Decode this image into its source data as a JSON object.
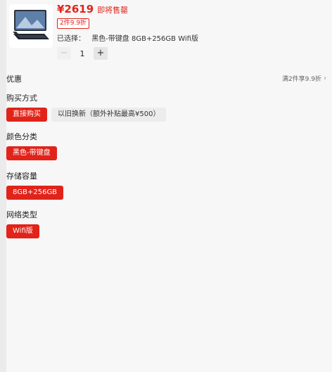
{
  "product": {
    "price": "¥2619",
    "presale": "即将售罄",
    "promo_tag": "2件9.9折",
    "selected_label": "已选择：",
    "selected_value": "黑色-带键盘 8GB+256GB Wifi版",
    "quantity": "1",
    "minus": "−",
    "plus": "+",
    "thumbnail_icon": "tablet-with-keyboard-icon"
  },
  "discount": {
    "label": "优惠",
    "value": "满2件享9.9折",
    "chevron": "›"
  },
  "purchase_method": {
    "label": "购买方式",
    "options": [
      "直接购买",
      "以旧换新（额外补贴最高¥500）"
    ],
    "selected": 0
  },
  "color": {
    "label": "颜色分类",
    "options": [
      "黑色-带键盘"
    ],
    "selected": 0
  },
  "storage": {
    "label": "存储容量",
    "options": [
      "8GB+256GB"
    ],
    "selected": 0
  },
  "network": {
    "label": "网络类型",
    "options": [
      "Wifi版"
    ],
    "selected": 0
  },
  "colors": {
    "accent": "#e2231a",
    "background": "#f7f7f7"
  }
}
